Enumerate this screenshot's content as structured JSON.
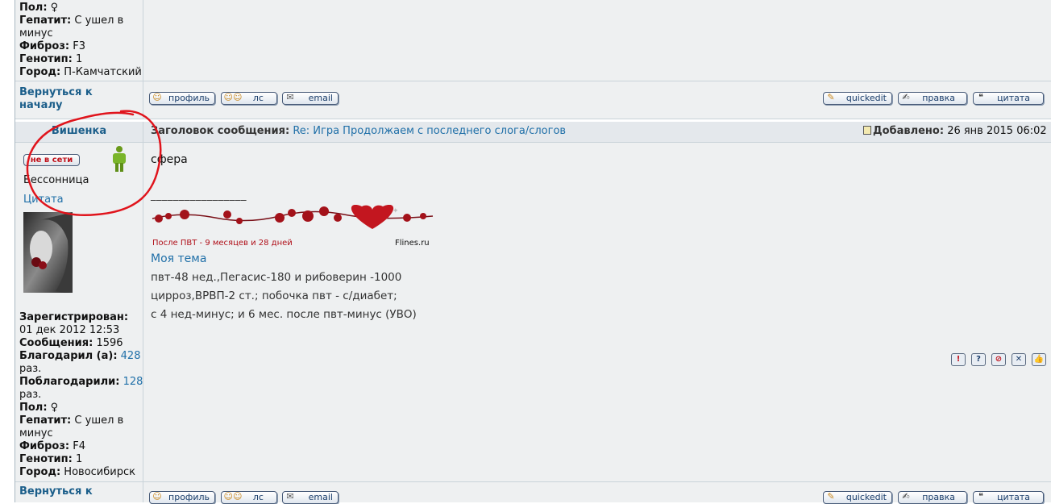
{
  "prev_profile": {
    "gender_label": "Пол:",
    "gender_value": "♀",
    "hep_label": "Гепатит:",
    "hep_value_1": "С ушел в",
    "hep_value_2": "минус",
    "fib_label": "Фиброз:",
    "fib_value": "F3",
    "geno_label": "Генотип:",
    "geno_value": "1",
    "city_label": "Город:",
    "city_value": "П-Камчатский"
  },
  "back_to_top_1": "Вернуться к",
  "back_to_top_2": "началу",
  "buttons": {
    "profile": "профиль",
    "pm": "лс",
    "email": "email",
    "quickedit": "quickedit",
    "edit": "правка",
    "quote": "цитата"
  },
  "post": {
    "author": "Вишенка",
    "subject_label": "Заголовок сообщения:",
    "subject_value": "Re: Игра Продолжаем с последнего слога/слогов",
    "added_label": "Добавлено:",
    "added_value": "26 янв 2015 06:02",
    "status": "не в сети",
    "user_title": "Бессонница",
    "quote_link": "Цитата",
    "body": "сфера",
    "signature_divider": "_________________",
    "banner_caption": "После ПВТ -  9 месяцев и 28 дней",
    "banner_site": "Flines.ru",
    "my_topic": "Моя тема",
    "sig_lines": [
      "пвт-48 нед.,Пегасис-180 и рибоверин -1000",
      "цирроз,ВРВП-2 ст.; побочка пвт - с/диабет;",
      "с 4 нед-минус; и 6 мес. после пвт-минус (УВО)"
    ]
  },
  "profile": {
    "reg_label": "Зарегистрирован:",
    "reg_value": "01 дек 2012 12:53",
    "posts_label": "Сообщения:",
    "posts_value": "1596",
    "thanked_label": "Благодарил (а):",
    "thanked_value": "428",
    "thanked_suffix": "раз.",
    "was_thanked_label": "Поблагодарили:",
    "was_thanked_value": "128",
    "was_thanked_suffix": "раз.",
    "gender_label": "Пол:",
    "gender_value": "♀",
    "hep_label": "Гепатит:",
    "hep_value_1": "С ушел в",
    "hep_value_2": "минус",
    "fib_label": "Фиброз:",
    "fib_value": "F4",
    "geno_label": "Генотип:",
    "geno_value": "1",
    "city_label": "Город:",
    "city_value": "Новосибирск"
  },
  "colors": {
    "link": "#1f6fa8",
    "annotation_circle": "#e0141c",
    "banner_red": "#a3121a"
  },
  "action_icons": [
    "report-icon",
    "help-icon",
    "ban-icon",
    "delete-icon",
    "thumbs-up-icon"
  ]
}
